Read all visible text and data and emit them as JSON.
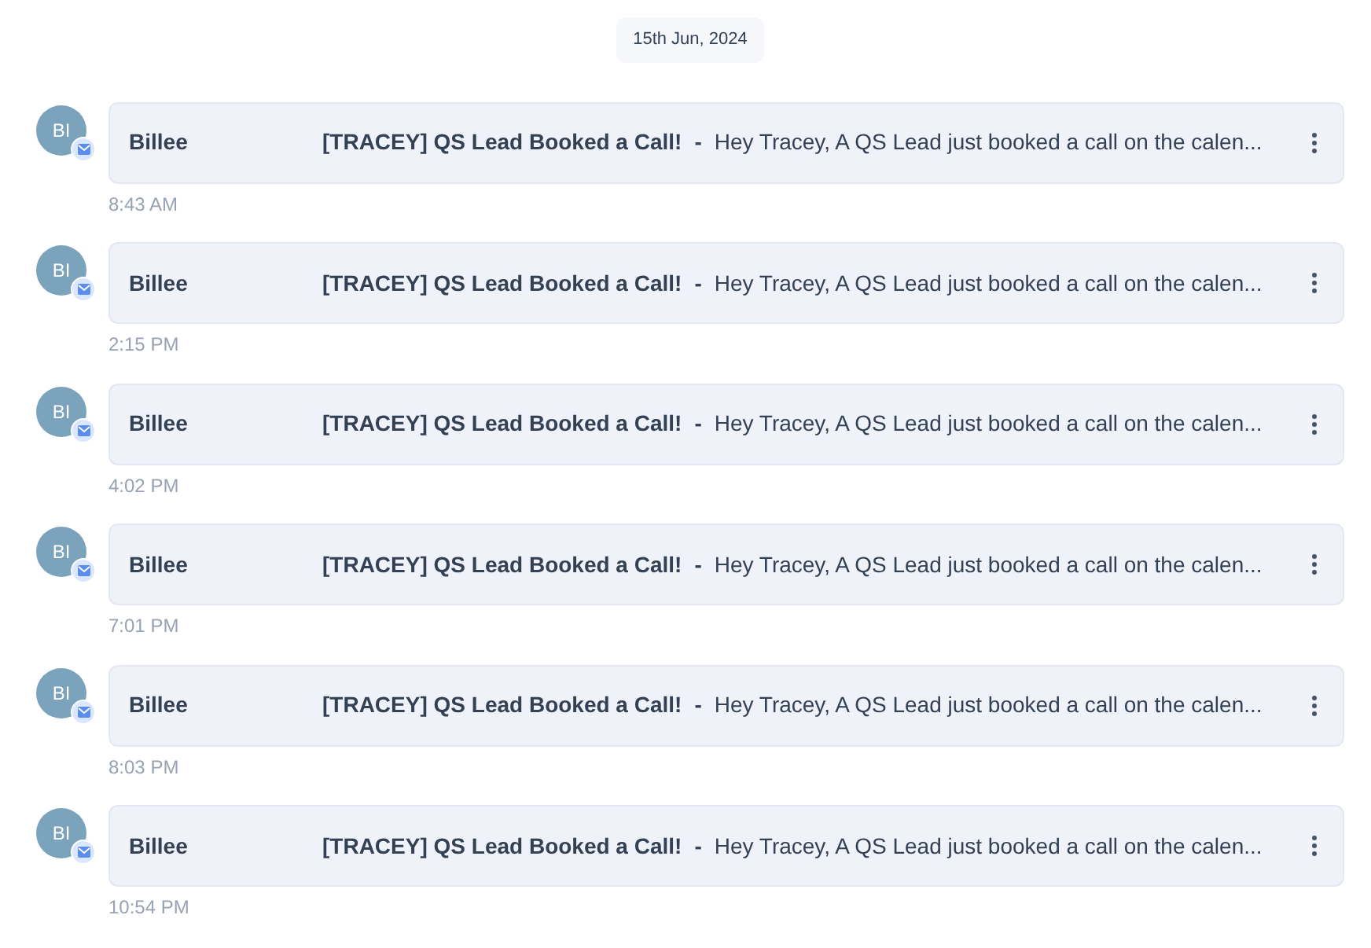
{
  "date_label": "15th Jun, 2024",
  "messages": [
    {
      "avatar": "BI",
      "sender": "Billee",
      "subject": "[TRACEY] QS Lead Booked a Call!",
      "separator": "-",
      "preview": "Hey Tracey, A QS Lead just booked a call on the calen...",
      "time": "8:43 AM"
    },
    {
      "avatar": "BI",
      "sender": "Billee",
      "subject": "[TRACEY] QS Lead Booked a Call!",
      "separator": "-",
      "preview": "Hey Tracey, A QS Lead just booked a call on the calen...",
      "time": "2:15 PM"
    },
    {
      "avatar": "BI",
      "sender": "Billee",
      "subject": "[TRACEY] QS Lead Booked a Call!",
      "separator": "-",
      "preview": "Hey Tracey, A QS Lead just booked a call on the calen...",
      "time": "4:02 PM"
    },
    {
      "avatar": "BI",
      "sender": "Billee",
      "subject": "[TRACEY] QS Lead Booked a Call!",
      "separator": "-",
      "preview": "Hey Tracey, A QS Lead just booked a call on the calen...",
      "time": "7:01 PM"
    },
    {
      "avatar": "BI",
      "sender": "Billee",
      "subject": "[TRACEY] QS Lead Booked a Call!",
      "separator": "-",
      "preview": "Hey Tracey, A QS Lead just booked a call on the calen...",
      "time": "8:03 PM"
    },
    {
      "avatar": "BI",
      "sender": "Billee",
      "subject": "[TRACEY] QS Lead Booked a Call!",
      "separator": "-",
      "preview": "Hey Tracey, A QS Lead just booked a call on the calen...",
      "time": "10:54 PM"
    }
  ]
}
